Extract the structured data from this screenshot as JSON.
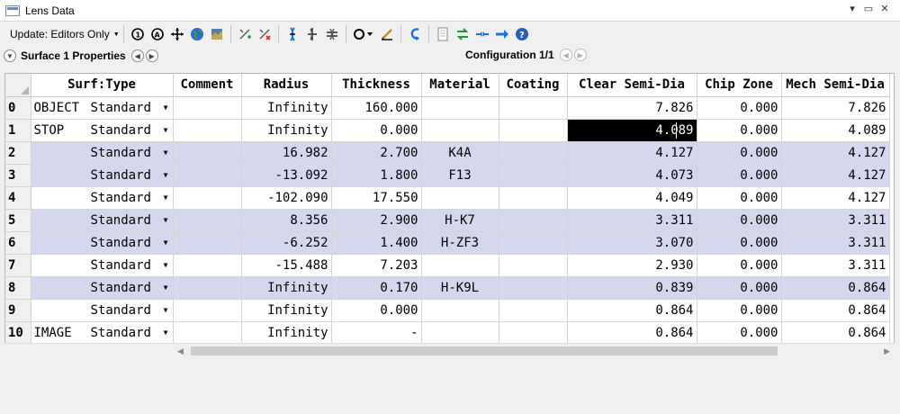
{
  "window": {
    "title": "Lens Data",
    "controls": [
      "▾",
      "▭",
      "✕"
    ]
  },
  "toolbar": {
    "update_label": "Update: Editors Only",
    "icons": [
      "refresh-one-icon",
      "refresh-all-icon",
      "move-icon",
      "globe-icon",
      "map-icon",
      "insert-surface-icon",
      "delete-surface-icon",
      "lens-pick-icon",
      "lens-tilt-icon",
      "lens-decenter-icon",
      "aperture-icon",
      "solve-icon",
      "undo-icon",
      "document-icon",
      "swap-icon",
      "collapse-icon",
      "arrow-right-icon",
      "help-icon"
    ]
  },
  "properties": {
    "label": "Surface 1 Properties",
    "config_label": "Configuration 1/1"
  },
  "columns": [
    "Surf:Type",
    "Comment",
    "Radius",
    "Thickness",
    "Material",
    "Coating",
    "Clear Semi-Dia",
    "Chip Zone",
    "Mech Semi-Dia"
  ],
  "rows": [
    {
      "num": "0",
      "name": "OBJECT",
      "type": "Standard",
      "comment": "",
      "radius": "Infinity",
      "thickness": "160.000",
      "material": "",
      "coating": "",
      "clear": "7.826",
      "chip": "0.000",
      "mech": "7.826"
    },
    {
      "num": "1",
      "name": "STOP",
      "type": "Standard",
      "comment": "",
      "radius": "Infinity",
      "thickness": "0.000",
      "material": "",
      "coating": "",
      "clear": "4.089",
      "chip": "0.000",
      "mech": "4.089"
    },
    {
      "num": "2",
      "name": "",
      "type": "Standard",
      "comment": "",
      "radius": "16.982",
      "thickness": "2.700",
      "material": "K4A",
      "coating": "",
      "clear": "4.127",
      "chip": "0.000",
      "mech": "4.127"
    },
    {
      "num": "3",
      "name": "",
      "type": "Standard",
      "comment": "",
      "radius": "-13.092",
      "thickness": "1.800",
      "material": "F13",
      "coating": "",
      "clear": "4.073",
      "chip": "0.000",
      "mech": "4.127"
    },
    {
      "num": "4",
      "name": "",
      "type": "Standard",
      "comment": "",
      "radius": "-102.090",
      "thickness": "17.550",
      "material": "",
      "coating": "",
      "clear": "4.049",
      "chip": "0.000",
      "mech": "4.127"
    },
    {
      "num": "5",
      "name": "",
      "type": "Standard",
      "comment": "",
      "radius": "8.356",
      "thickness": "2.900",
      "material": "H-K7",
      "coating": "",
      "clear": "3.311",
      "chip": "0.000",
      "mech": "3.311"
    },
    {
      "num": "6",
      "name": "",
      "type": "Standard",
      "comment": "",
      "radius": "-6.252",
      "thickness": "1.400",
      "material": "H-ZF3",
      "coating": "",
      "clear": "3.070",
      "chip": "0.000",
      "mech": "3.311"
    },
    {
      "num": "7",
      "name": "",
      "type": "Standard",
      "comment": "",
      "radius": "-15.488",
      "thickness": "7.203",
      "material": "",
      "coating": "",
      "clear": "2.930",
      "chip": "0.000",
      "mech": "3.311"
    },
    {
      "num": "8",
      "name": "",
      "type": "Standard",
      "comment": "",
      "radius": "Infinity",
      "thickness": "0.170",
      "material": "H-K9L",
      "coating": "",
      "clear": "0.839",
      "chip": "0.000",
      "mech": "0.864"
    },
    {
      "num": "9",
      "name": "",
      "type": "Standard",
      "comment": "",
      "radius": "Infinity",
      "thickness": "0.000",
      "material": "",
      "coating": "",
      "clear": "0.864",
      "chip": "0.000",
      "mech": "0.864"
    },
    {
      "num": "10",
      "name": "IMAGE",
      "type": "Standard",
      "comment": "",
      "radius": "Infinity",
      "thickness": "-",
      "material": "",
      "coating": "",
      "clear": "0.864",
      "chip": "0.000",
      "mech": "0.864"
    }
  ],
  "highlighted_rows": [
    2,
    3,
    5,
    6,
    8
  ],
  "colors": {
    "row_highlight": "#d5d7ef",
    "active_cell": "#000000",
    "accent": "#1e6fd9"
  }
}
